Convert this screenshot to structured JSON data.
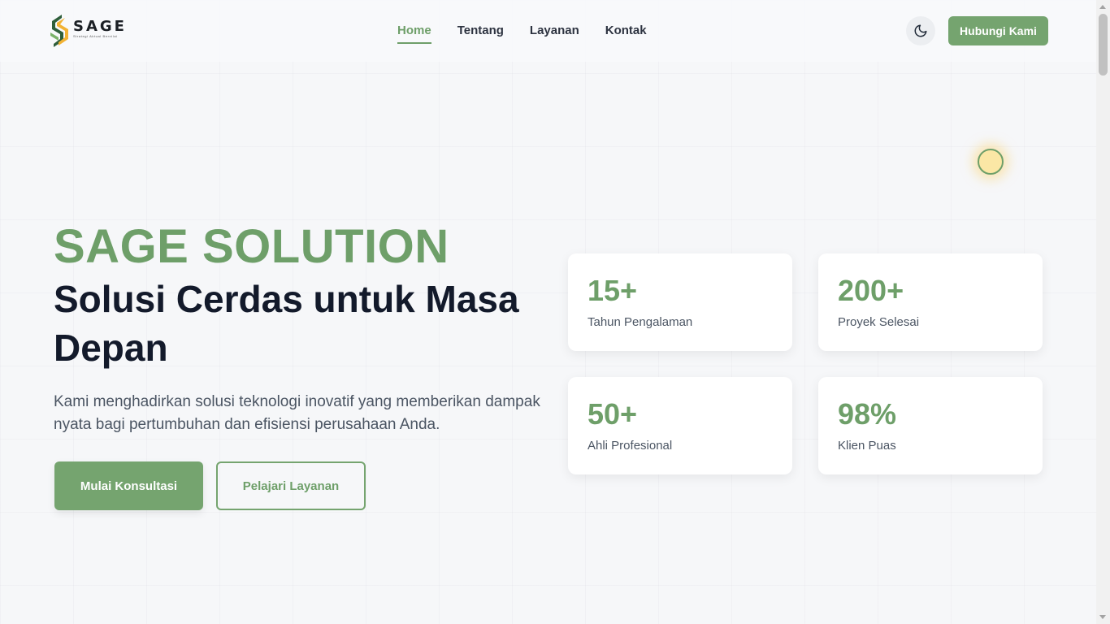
{
  "brand": {
    "name": "SAGE",
    "tagline": "Strategi Aktual Bernilai"
  },
  "nav": {
    "items": [
      {
        "label": "Home",
        "active": true
      },
      {
        "label": "Tentang",
        "active": false
      },
      {
        "label": "Layanan",
        "active": false
      },
      {
        "label": "Kontak",
        "active": false
      }
    ],
    "theme_toggle_icon": "moon-icon",
    "cta_label": "Hubungi Kami"
  },
  "hero": {
    "brand_title": "SAGE SOLUTION",
    "title": "Solusi Cerdas untuk Masa Depan",
    "description": "Kami menghadirkan solusi teknologi inovatif yang memberikan dampak nyata bagi pertumbuhan dan efisiensi perusahaan Anda.",
    "primary_button": "Mulai Konsultasi",
    "secondary_button": "Pelajari Layanan"
  },
  "stats": [
    {
      "value": "15+",
      "label": "Tahun Pengalaman"
    },
    {
      "value": "200+",
      "label": "Proyek Selesai"
    },
    {
      "value": "50+",
      "label": "Ahli Profesional"
    },
    {
      "value": "98%",
      "label": "Klien Puas"
    }
  ],
  "colors": {
    "accent": "#75a46f",
    "accent_text": "#6e9f69",
    "heading": "#131a2b",
    "background": "#f6f7f9"
  }
}
